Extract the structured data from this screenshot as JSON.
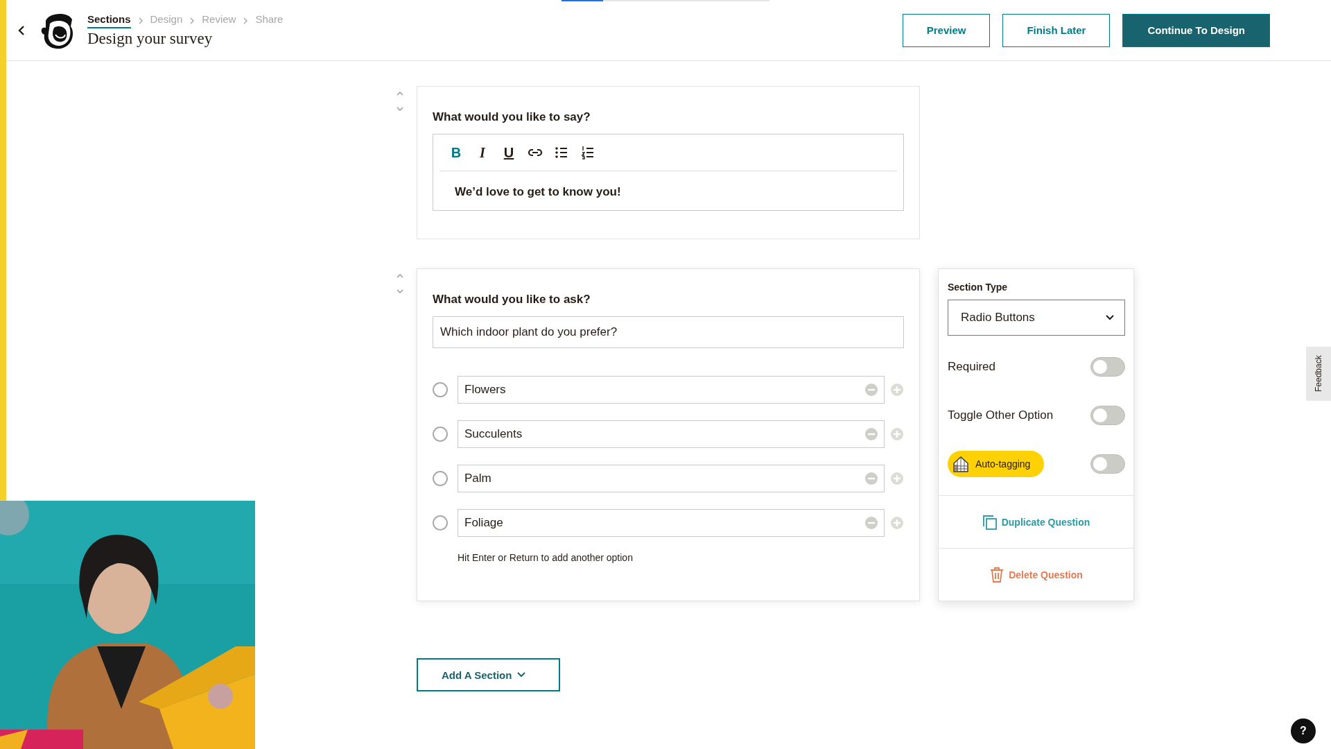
{
  "header": {
    "progress": {
      "level": 0.2
    },
    "breadcrumb": [
      {
        "label": "Sections",
        "selected": true
      },
      {
        "label": "Design",
        "selected": false
      },
      {
        "label": "Review",
        "selected": false
      },
      {
        "label": "Share",
        "selected": false
      }
    ],
    "title": "Design your survey",
    "buttons": [
      {
        "label": "Preview",
        "kind": "outline"
      },
      {
        "label": "Finish Later",
        "kind": "outline"
      },
      {
        "label": "Continue To Design",
        "kind": "primary"
      }
    ]
  },
  "sections": [
    {
      "kind": "text",
      "prompt": "What would you like to say?",
      "toolbar": [
        {
          "kind": "bold",
          "label": "B",
          "active": true
        },
        {
          "kind": "italic",
          "label": "I",
          "active": false
        },
        {
          "kind": "underline",
          "label": "U",
          "active": false
        },
        {
          "kind": "link",
          "active": false
        },
        {
          "kind": "bullets",
          "active": false
        },
        {
          "kind": "numbers",
          "active": false
        }
      ],
      "body": "We’d love to get to know you!"
    },
    {
      "kind": "radio",
      "prompt": "What would you like to ask?",
      "question": "Which indoor plant do you prefer?",
      "options": [
        {
          "label": "Flowers",
          "selected": false
        },
        {
          "label": "Succulents",
          "selected": false
        },
        {
          "label": "Palm",
          "selected": false
        },
        {
          "label": "Foliage",
          "selected": false
        }
      ],
      "hint": "Hit Enter or Return to add another option"
    }
  ],
  "settings": {
    "section_type_label": "Section Type",
    "section_type": "Radio Buttons",
    "toggles": [
      {
        "kind": "text",
        "label": "Required",
        "on": false
      },
      {
        "kind": "text",
        "label": "Toggle Other Option",
        "on": false
      },
      {
        "kind": "badge",
        "label": "Auto-tagging",
        "on": false
      }
    ],
    "actions": [
      {
        "kind": "duplicate",
        "label": "Duplicate Question"
      },
      {
        "kind": "delete",
        "label": "Delete Question"
      }
    ]
  },
  "add_section": "Add A Section",
  "feedback": "Feedback",
  "help": "?"
}
